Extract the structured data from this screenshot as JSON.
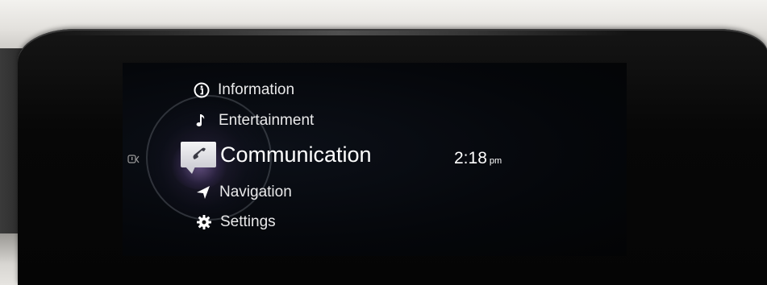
{
  "menu": {
    "items": [
      {
        "label": "Information",
        "icon": "info-icon"
      },
      {
        "label": "Entertainment",
        "icon": "music-note-icon"
      },
      {
        "label": "Communication",
        "icon": "phone-chat-icon",
        "selected": true
      },
      {
        "label": "Navigation",
        "icon": "navigation-arrow-icon"
      },
      {
        "label": "Settings",
        "icon": "gear-icon"
      }
    ]
  },
  "clock": {
    "time": "2:18",
    "ampm": "pm"
  },
  "colors": {
    "text": "#e9e9ea",
    "screen_bg": "#05070b",
    "selected": "#ffffff"
  }
}
